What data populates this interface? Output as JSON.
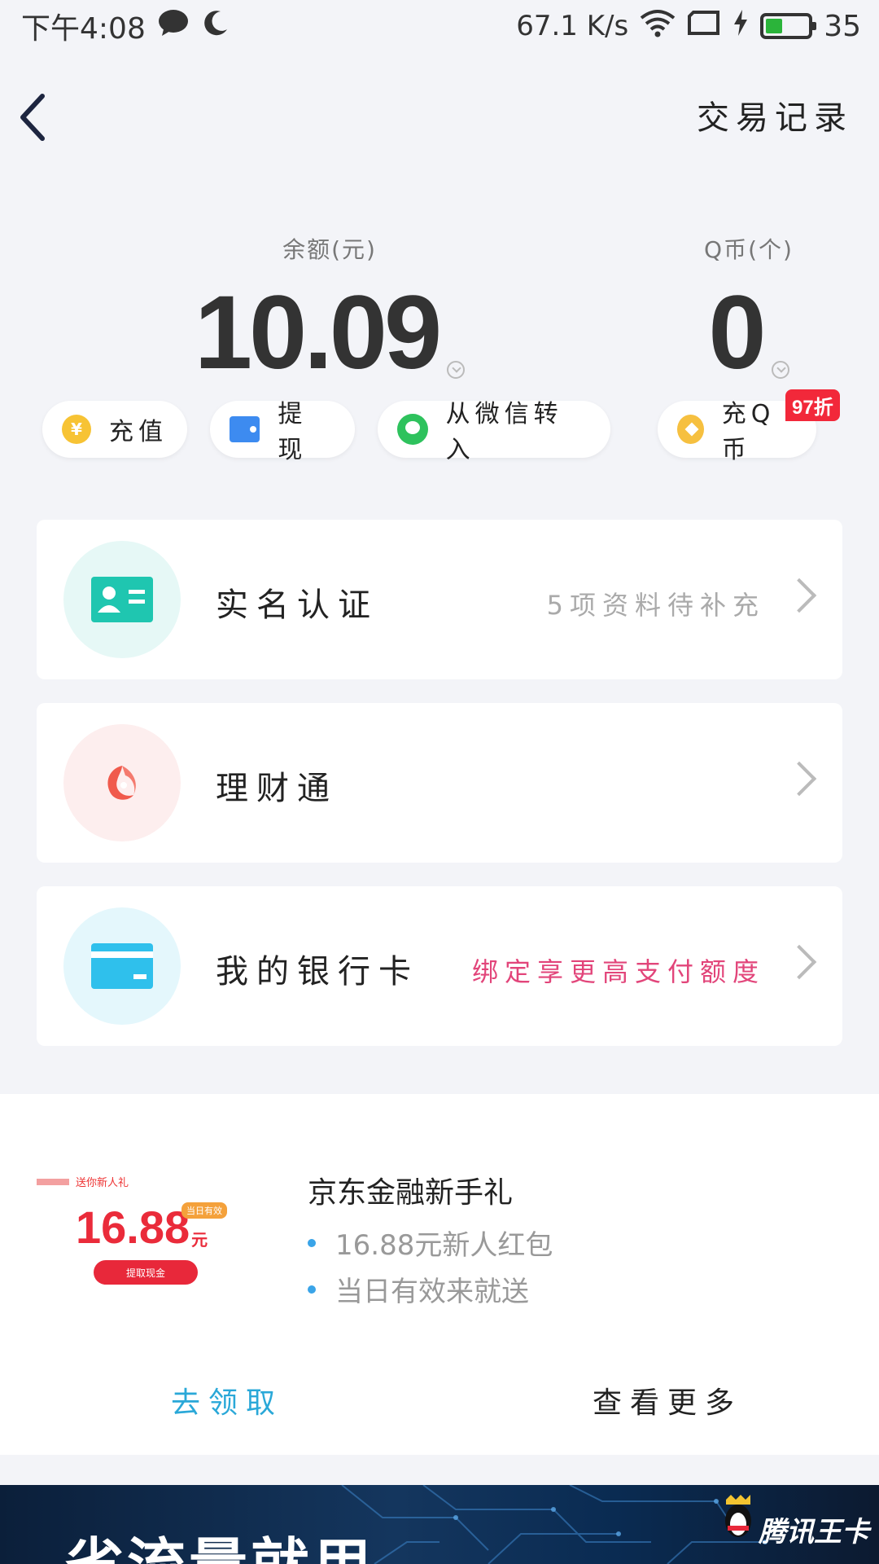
{
  "status_bar": {
    "time": "下午4:08",
    "net_speed": "67.1 K/s",
    "battery": "35",
    "battery_level": 0.35
  },
  "header": {
    "title_link": "交易记录"
  },
  "balance": {
    "label": "余额(元)",
    "value": "10.09"
  },
  "qcoin": {
    "label": "Q币(个)",
    "value": "0"
  },
  "actions": [
    {
      "label": "充值",
      "icon": "yuan-coin-icon"
    },
    {
      "label": "提现",
      "icon": "wallet-icon"
    },
    {
      "label": "从微信转入",
      "icon": "wechat-icon"
    },
    {
      "label": "充Q币",
      "icon": "qcoin-icon"
    }
  ],
  "discount_badge": "97折",
  "cards": [
    {
      "title": "实名认证",
      "hint": "5项资料待补充",
      "hint_color": "#aaaaaa",
      "icon": "id-card-icon"
    },
    {
      "title": "理财通",
      "hint": "",
      "icon": "licaitong-icon"
    },
    {
      "title": "我的银行卡",
      "hint": "绑定享更高支付额度",
      "hint_color": "#e2457a",
      "icon": "bank-card-icon"
    }
  ],
  "promo": {
    "title": "京东金融新手礼",
    "bullets": [
      "16.88元新人红包",
      "当日有效来就送"
    ],
    "image": {
      "tag": "送你新人礼",
      "amount": "16.88",
      "unit": "元",
      "badge": "当日有效",
      "button": "提取现金"
    },
    "claim_label": "去领取",
    "more_label": "查看更多",
    "accent": "#2aa8d8"
  },
  "banner": {
    "text": "省流量就用",
    "brand": "腾讯王卡"
  }
}
